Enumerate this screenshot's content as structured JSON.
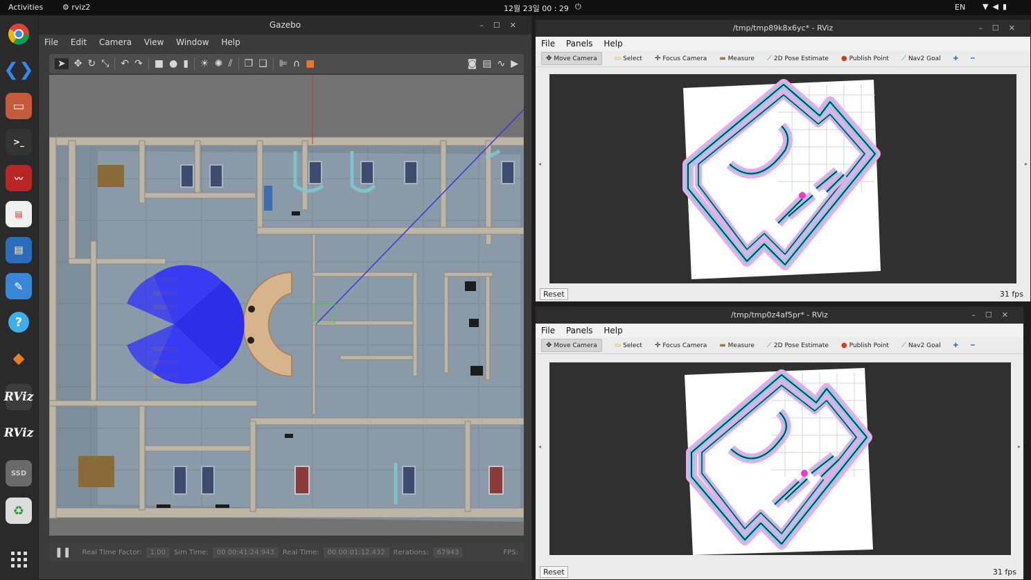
{
  "topbar": {
    "activities": "Activities",
    "app_name": "rviz2",
    "clock": "12월 23일 00 : 29",
    "language": "EN"
  },
  "dock": {
    "rviz_label_1": "RViz",
    "rviz_label_2": "RViz",
    "ssd_label": "SSD"
  },
  "gazebo": {
    "title": "Gazebo",
    "menu": {
      "file": "File",
      "edit": "Edit",
      "camera": "Camera",
      "view": "View",
      "window": "Window",
      "help": "Help"
    },
    "status": {
      "real_time_factor_label": "Real Time Factor:",
      "real_time_factor": "1.00",
      "sim_time_label": "Sim Time:",
      "sim_time": "00 00:41:24.943",
      "real_time_label": "Real Time:",
      "real_time": "00 00:01:12.432",
      "iterations_label": "Iterations:",
      "iterations": "67943",
      "fps_label": "FPS:"
    }
  },
  "rviz1": {
    "title": "/tmp/tmp89k8x6yc* - RViz",
    "fps": "31 fps"
  },
  "rviz2": {
    "title": "/tmp/tmp0z4af5pr* - RViz",
    "fps": "31 fps"
  },
  "rviz_common": {
    "menu": {
      "file": "File",
      "panels": "Panels",
      "help": "Help"
    },
    "tools": {
      "move_camera": "Move Camera",
      "select": "Select",
      "focus_camera": "Focus Camera",
      "measure": "Measure",
      "pose_estimate": "2D Pose Estimate",
      "publish_point": "Publish Point",
      "nav2_goal": "Nav2 Goal"
    },
    "reset": "Reset"
  }
}
